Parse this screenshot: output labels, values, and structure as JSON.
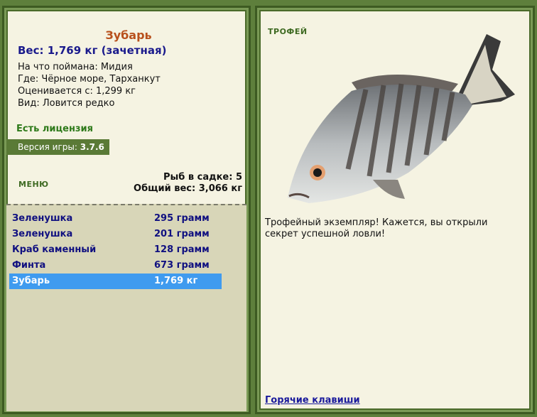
{
  "fish": {
    "name": "Зубарь",
    "weight_line": "Вес: 1,769 кг (зачетная)",
    "bait": "На что поймана: Мидия",
    "location": "Где: Чёрное море, Тарханкут",
    "valued": "Оценивается с: 1,299 кг",
    "species": "Вид: Ловится редко"
  },
  "license": "Есть лицензия",
  "version": {
    "label": "Версия игры:",
    "value": "3.7.6"
  },
  "menu_label": "МЕНЮ",
  "cage": {
    "count": "Рыб в садке: 5",
    "total": "Общий вес: 3,066 кг"
  },
  "catches": [
    {
      "name": "Зеленушка",
      "weight": "295 грамм"
    },
    {
      "name": "Зеленушка",
      "weight": "201 грамм"
    },
    {
      "name": "Краб каменный",
      "weight": "128 грамм"
    },
    {
      "name": "Финта",
      "weight": "673 грамм"
    },
    {
      "name": "Зубарь",
      "weight": "1,769 кг"
    }
  ],
  "trophy_label": "ТРОФЕЙ",
  "description": "Трофейный экземпляр! Кажется, вы открыли секрет успешной ловли!",
  "hotkeys": "Горячие клавиши"
}
